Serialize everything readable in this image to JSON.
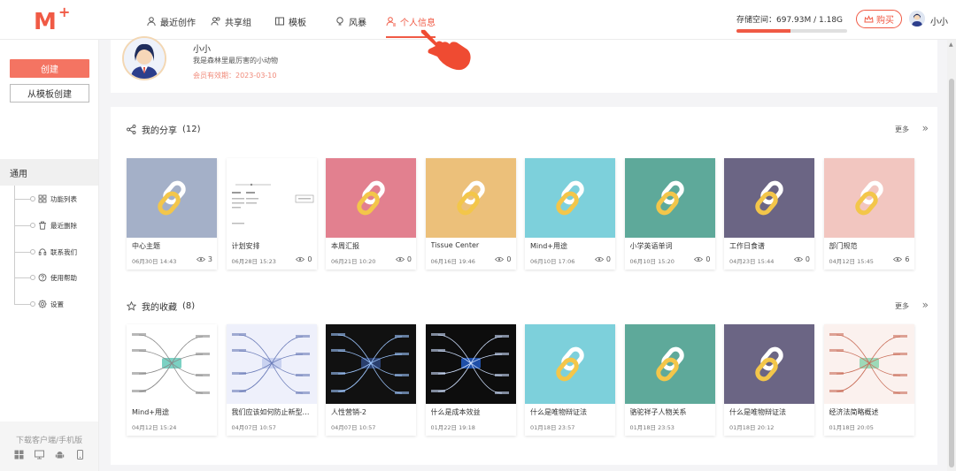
{
  "nav": {
    "items": [
      {
        "label": "最近创作",
        "icon": "user-icon"
      },
      {
        "label": "共享组",
        "icon": "group-icon"
      },
      {
        "label": "模板",
        "icon": "template-icon"
      },
      {
        "label": "风暴",
        "icon": "lightbulb-icon"
      },
      {
        "label": "个人信息",
        "icon": "profile-icon",
        "active": true
      }
    ]
  },
  "storage": {
    "label": "存储空间：697.93M / 1.18G",
    "used_fraction": 0.49
  },
  "buy_label": "购买",
  "username": "小小",
  "sidebar": {
    "create_label": "创建",
    "template_label": "从模板创建",
    "section_title": "通用",
    "items": [
      {
        "label": "功能列表",
        "icon": "grid-icon"
      },
      {
        "label": "最近删除",
        "icon": "trash-icon"
      },
      {
        "label": "联系我们",
        "icon": "headset-icon"
      },
      {
        "label": "使用帮助",
        "icon": "help-icon"
      },
      {
        "label": "设置",
        "icon": "gear-icon"
      }
    ],
    "download_label": "下载客户端/手机版"
  },
  "profile": {
    "name": "小小",
    "description": "我是森林里最厉害的小动物",
    "expire": "会员有效期：2023-03-10"
  },
  "shares": {
    "title": "我的分享",
    "count": "(12)",
    "more": "更多",
    "items": [
      {
        "title": "中心主题",
        "date": "06月30日 14:43",
        "views": "3",
        "color": "#a4b0c8",
        "thumb": "link"
      },
      {
        "title": "计划安排",
        "date": "06月28日 15:23",
        "views": "0",
        "color": "#ffffff",
        "thumb": "mindmap-light"
      },
      {
        "title": "本周汇报",
        "date": "06月21日 10:20",
        "views": "0",
        "color": "#e2808f",
        "thumb": "link"
      },
      {
        "title": "Tissue Center",
        "date": "06月16日 19:46",
        "views": "0",
        "color": "#ecc07a",
        "thumb": "link"
      },
      {
        "title": "Mind+用途",
        "date": "06月10日 17:06",
        "views": "0",
        "color": "#7dd0db",
        "thumb": "link"
      },
      {
        "title": "小学英语单词",
        "date": "06月10日 15:20",
        "views": "0",
        "color": "#5ea99a",
        "thumb": "link"
      },
      {
        "title": "工作日食谱",
        "date": "04月23日 15:44",
        "views": "0",
        "color": "#6b6584",
        "thumb": "link"
      },
      {
        "title": "部门规范",
        "date": "04月12日 15:45",
        "views": "6",
        "color": "#f2c6c0",
        "thumb": "link"
      }
    ]
  },
  "favorites": {
    "title": "我的收藏",
    "count": "(8)",
    "more": "更多",
    "items": [
      {
        "title": "Mind+用途",
        "date": "04月12日 15:24",
        "color": "#ffffff",
        "thumb": "mindmap-color"
      },
      {
        "title": "我们应该如何防止新型冠...",
        "date": "04月07日 10:57",
        "color": "#eef0fb",
        "thumb": "mindmap-blue"
      },
      {
        "title": "人性营销-2",
        "date": "04月07日 10:57",
        "color": "#111111",
        "thumb": "mindmap-dark"
      },
      {
        "title": "什么是成本效益",
        "date": "01月22日 19:18",
        "color": "#0d0d0d",
        "thumb": "mindmap-dark2"
      },
      {
        "title": "什么是唯物辩证法",
        "date": "01月18日 23:57",
        "color": "#7dd0db",
        "thumb": "link"
      },
      {
        "title": "骆驼祥子人物关系",
        "date": "01月18日 23:53",
        "color": "#5ea99a",
        "thumb": "link"
      },
      {
        "title": "什么是唯物辩证法",
        "date": "01月18日 20:12",
        "color": "#6b6584",
        "thumb": "link"
      },
      {
        "title": "经济法简略概述",
        "date": "01月18日 20:05",
        "color": "#fbf1ee",
        "thumb": "mindmap-pink"
      }
    ]
  },
  "colors": {
    "accent": "#f05a45",
    "accent_light": "#f47462"
  }
}
